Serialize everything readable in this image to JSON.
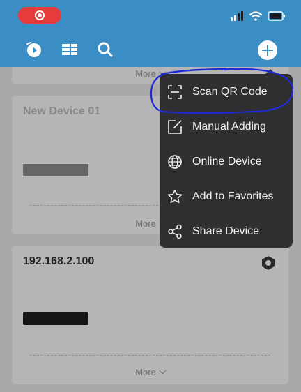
{
  "colors": {
    "header_blue": "#3b8ec4",
    "record_red": "#e53b3b",
    "menu_bg": "#2f2f31",
    "annotation_blue": "#1f2bd6"
  },
  "statusbar": {
    "icons": [
      "record-indicator-icon",
      "signal-icon",
      "wifi-icon",
      "battery-icon"
    ]
  },
  "toolbar": {
    "icons": [
      "playback-icon",
      "device-list-icon",
      "search-icon",
      "add-icon"
    ]
  },
  "devices": [
    {
      "more_label": "More"
    },
    {
      "title": "New Device 01",
      "more_label": "More"
    },
    {
      "title": "192.168.2.100",
      "more_label": "More"
    }
  ],
  "menu": {
    "items": [
      {
        "label": "Scan QR Code",
        "icon": "scan-qr-icon"
      },
      {
        "label": "Manual Adding",
        "icon": "edit-icon"
      },
      {
        "label": "Online Device",
        "icon": "globe-icon"
      },
      {
        "label": "Add to Favorites",
        "icon": "star-icon"
      },
      {
        "label": "Share Device",
        "icon": "share-icon"
      }
    ]
  }
}
